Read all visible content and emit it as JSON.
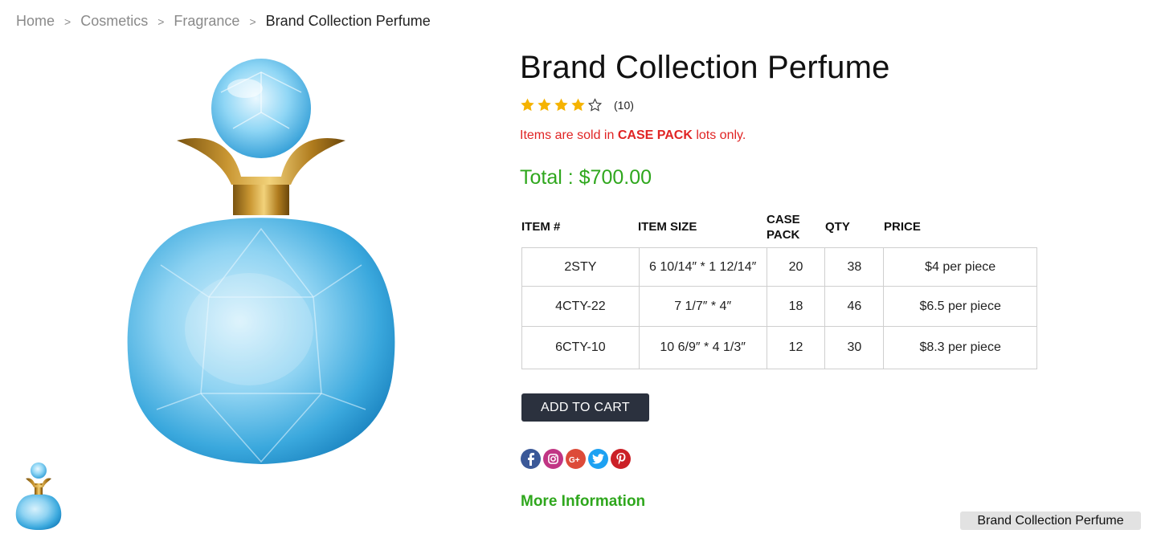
{
  "breadcrumb": {
    "items": [
      "Home",
      "Cosmetics",
      "Fragrance"
    ],
    "current": "Brand Collection Perfume",
    "separator": ">"
  },
  "product": {
    "title": "Brand Collection Perfume",
    "rating": 4,
    "rating_max": 5,
    "rating_count": "(10)",
    "notice_prefix": "Items are sold in ",
    "notice_emphasis": "CASE PACK",
    "notice_suffix": " lots only.",
    "total": "Total : $700.00",
    "image": "perfume-bottle",
    "thumbnail": "perfume-bottle-thumb"
  },
  "table": {
    "headers": [
      "ITEM #",
      "ITEM SIZE",
      "CASE PACK",
      "QTY",
      "PRICE"
    ],
    "rows": [
      [
        "2STY",
        "6 10/14″ * 1 12/14″",
        "20",
        "38",
        "$4 per piece"
      ],
      [
        "4CTY-22",
        "7 1/7″ * 4″",
        "18",
        "46",
        "$6.5 per piece"
      ],
      [
        "6CTY-10",
        "10 6/9″ * 4 1/3″",
        "12",
        "30",
        "$8.3 per piece"
      ]
    ]
  },
  "actions": {
    "add_to_cart": "ADD TO CART",
    "more_info": "More Information"
  },
  "social": [
    {
      "name": "facebook-icon",
      "color": "#3b5998",
      "glyph": "f"
    },
    {
      "name": "instagram-icon",
      "color": "#c13584",
      "glyph": ""
    },
    {
      "name": "google-plus-icon",
      "color": "#dd4b39",
      "glyph": "G+"
    },
    {
      "name": "twitter-icon",
      "color": "#1da1f2",
      "glyph": ""
    },
    {
      "name": "pinterest-icon",
      "color": "#cb2027",
      "glyph": "P"
    }
  ],
  "tooltip": "Brand Collection Perfume",
  "colors": {
    "accent_green": "#2fa71d",
    "notice_red": "#e02424",
    "button_bg": "#2b313e",
    "star_gold": "#f5b301"
  }
}
